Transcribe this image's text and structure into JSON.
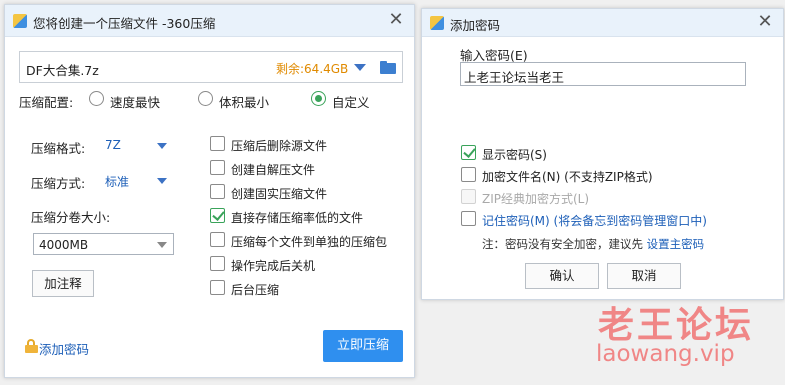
{
  "compress_dialog": {
    "title": "您将创建一个压缩文件 -360压缩",
    "path_value": "DF大合集.7z",
    "free_space": "剩余:64.4GB",
    "config_label": "压缩配置:",
    "modes": [
      {
        "label": "速度最快",
        "selected": false
      },
      {
        "label": "体积最小",
        "selected": false
      },
      {
        "label": "自定义",
        "selected": true
      }
    ],
    "format_label": "压缩格式:",
    "format_value": "7Z",
    "method_label": "压缩方式:",
    "method_value": "标准",
    "split_label": "压缩分卷大小:",
    "split_value": "4000MB",
    "comment_button": "加注释",
    "options": [
      {
        "label": "压缩后删除源文件",
        "checked": false
      },
      {
        "label": "创建自解压文件",
        "checked": false
      },
      {
        "label": "创建固实压缩文件",
        "checked": false
      },
      {
        "label": "直接存储压缩率低的文件",
        "checked": true
      },
      {
        "label": "压缩每个文件到单独的压缩包",
        "checked": false
      },
      {
        "label": "操作完成后关机",
        "checked": false
      },
      {
        "label": "后台压缩",
        "checked": false
      }
    ],
    "add_password_link": "添加密码",
    "compress_button": "立即压缩"
  },
  "password_dialog": {
    "title": "添加密码",
    "input_label": "输入密码(E)",
    "password_value": "上老王论坛当老王",
    "options": [
      {
        "label": "显示密码(S)",
        "checked": true,
        "disabled": false,
        "link": false
      },
      {
        "label": "加密文件名(N) (不支持ZIP格式)",
        "checked": false,
        "disabled": false,
        "link": false
      },
      {
        "label": "ZIP经典加密方式(L)",
        "checked": false,
        "disabled": true,
        "link": false
      },
      {
        "label": "记住密码(M) (将会备忘到密码管理窗口中)",
        "checked": false,
        "disabled": false,
        "link": true
      }
    ],
    "note_prefix": "注：密码没有安全加密，建议先 ",
    "note_link": "设置主密码",
    "ok_button": "确认",
    "cancel_button": "取消"
  },
  "watermark": {
    "line1": "老王论坛",
    "line2": "laowang.vip"
  },
  "colors": {
    "accent_blue": "#2f8fef",
    "link_blue": "#1d5fb8",
    "check_green": "#3aa35a",
    "free_space_orange": "#e08a00",
    "watermark_red": "#f07b7b"
  }
}
